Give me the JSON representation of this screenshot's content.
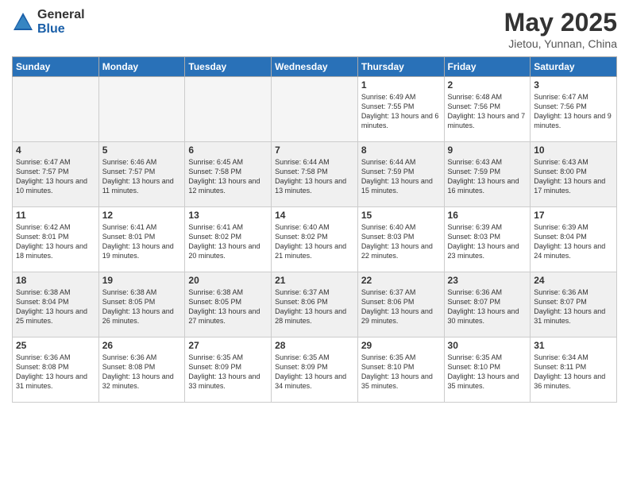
{
  "logo": {
    "general": "General",
    "blue": "Blue"
  },
  "header": {
    "title": "May 2025",
    "subtitle": "Jietou, Yunnan, China"
  },
  "days_of_week": [
    "Sunday",
    "Monday",
    "Tuesday",
    "Wednesday",
    "Thursday",
    "Friday",
    "Saturday"
  ],
  "weeks": [
    [
      {
        "day": "",
        "info": ""
      },
      {
        "day": "",
        "info": ""
      },
      {
        "day": "",
        "info": ""
      },
      {
        "day": "",
        "info": ""
      },
      {
        "day": "1",
        "info": "Sunrise: 6:49 AM\nSunset: 7:55 PM\nDaylight: 13 hours\nand 6 minutes."
      },
      {
        "day": "2",
        "info": "Sunrise: 6:48 AM\nSunset: 7:56 PM\nDaylight: 13 hours\nand 7 minutes."
      },
      {
        "day": "3",
        "info": "Sunrise: 6:47 AM\nSunset: 7:56 PM\nDaylight: 13 hours\nand 9 minutes."
      }
    ],
    [
      {
        "day": "4",
        "info": "Sunrise: 6:47 AM\nSunset: 7:57 PM\nDaylight: 13 hours\nand 10 minutes."
      },
      {
        "day": "5",
        "info": "Sunrise: 6:46 AM\nSunset: 7:57 PM\nDaylight: 13 hours\nand 11 minutes."
      },
      {
        "day": "6",
        "info": "Sunrise: 6:45 AM\nSunset: 7:58 PM\nDaylight: 13 hours\nand 12 minutes."
      },
      {
        "day": "7",
        "info": "Sunrise: 6:44 AM\nSunset: 7:58 PM\nDaylight: 13 hours\nand 13 minutes."
      },
      {
        "day": "8",
        "info": "Sunrise: 6:44 AM\nSunset: 7:59 PM\nDaylight: 13 hours\nand 15 minutes."
      },
      {
        "day": "9",
        "info": "Sunrise: 6:43 AM\nSunset: 7:59 PM\nDaylight: 13 hours\nand 16 minutes."
      },
      {
        "day": "10",
        "info": "Sunrise: 6:43 AM\nSunset: 8:00 PM\nDaylight: 13 hours\nand 17 minutes."
      }
    ],
    [
      {
        "day": "11",
        "info": "Sunrise: 6:42 AM\nSunset: 8:01 PM\nDaylight: 13 hours\nand 18 minutes."
      },
      {
        "day": "12",
        "info": "Sunrise: 6:41 AM\nSunset: 8:01 PM\nDaylight: 13 hours\nand 19 minutes."
      },
      {
        "day": "13",
        "info": "Sunrise: 6:41 AM\nSunset: 8:02 PM\nDaylight: 13 hours\nand 20 minutes."
      },
      {
        "day": "14",
        "info": "Sunrise: 6:40 AM\nSunset: 8:02 PM\nDaylight: 13 hours\nand 21 minutes."
      },
      {
        "day": "15",
        "info": "Sunrise: 6:40 AM\nSunset: 8:03 PM\nDaylight: 13 hours\nand 22 minutes."
      },
      {
        "day": "16",
        "info": "Sunrise: 6:39 AM\nSunset: 8:03 PM\nDaylight: 13 hours\nand 23 minutes."
      },
      {
        "day": "17",
        "info": "Sunrise: 6:39 AM\nSunset: 8:04 PM\nDaylight: 13 hours\nand 24 minutes."
      }
    ],
    [
      {
        "day": "18",
        "info": "Sunrise: 6:38 AM\nSunset: 8:04 PM\nDaylight: 13 hours\nand 25 minutes."
      },
      {
        "day": "19",
        "info": "Sunrise: 6:38 AM\nSunset: 8:05 PM\nDaylight: 13 hours\nand 26 minutes."
      },
      {
        "day": "20",
        "info": "Sunrise: 6:38 AM\nSunset: 8:05 PM\nDaylight: 13 hours\nand 27 minutes."
      },
      {
        "day": "21",
        "info": "Sunrise: 6:37 AM\nSunset: 8:06 PM\nDaylight: 13 hours\nand 28 minutes."
      },
      {
        "day": "22",
        "info": "Sunrise: 6:37 AM\nSunset: 8:06 PM\nDaylight: 13 hours\nand 29 minutes."
      },
      {
        "day": "23",
        "info": "Sunrise: 6:36 AM\nSunset: 8:07 PM\nDaylight: 13 hours\nand 30 minutes."
      },
      {
        "day": "24",
        "info": "Sunrise: 6:36 AM\nSunset: 8:07 PM\nDaylight: 13 hours\nand 31 minutes."
      }
    ],
    [
      {
        "day": "25",
        "info": "Sunrise: 6:36 AM\nSunset: 8:08 PM\nDaylight: 13 hours\nand 31 minutes."
      },
      {
        "day": "26",
        "info": "Sunrise: 6:36 AM\nSunset: 8:08 PM\nDaylight: 13 hours\nand 32 minutes."
      },
      {
        "day": "27",
        "info": "Sunrise: 6:35 AM\nSunset: 8:09 PM\nDaylight: 13 hours\nand 33 minutes."
      },
      {
        "day": "28",
        "info": "Sunrise: 6:35 AM\nSunset: 8:09 PM\nDaylight: 13 hours\nand 34 minutes."
      },
      {
        "day": "29",
        "info": "Sunrise: 6:35 AM\nSunset: 8:10 PM\nDaylight: 13 hours\nand 35 minutes."
      },
      {
        "day": "30",
        "info": "Sunrise: 6:35 AM\nSunset: 8:10 PM\nDaylight: 13 hours\nand 35 minutes."
      },
      {
        "day": "31",
        "info": "Sunrise: 6:34 AM\nSunset: 8:11 PM\nDaylight: 13 hours\nand 36 minutes."
      }
    ]
  ]
}
